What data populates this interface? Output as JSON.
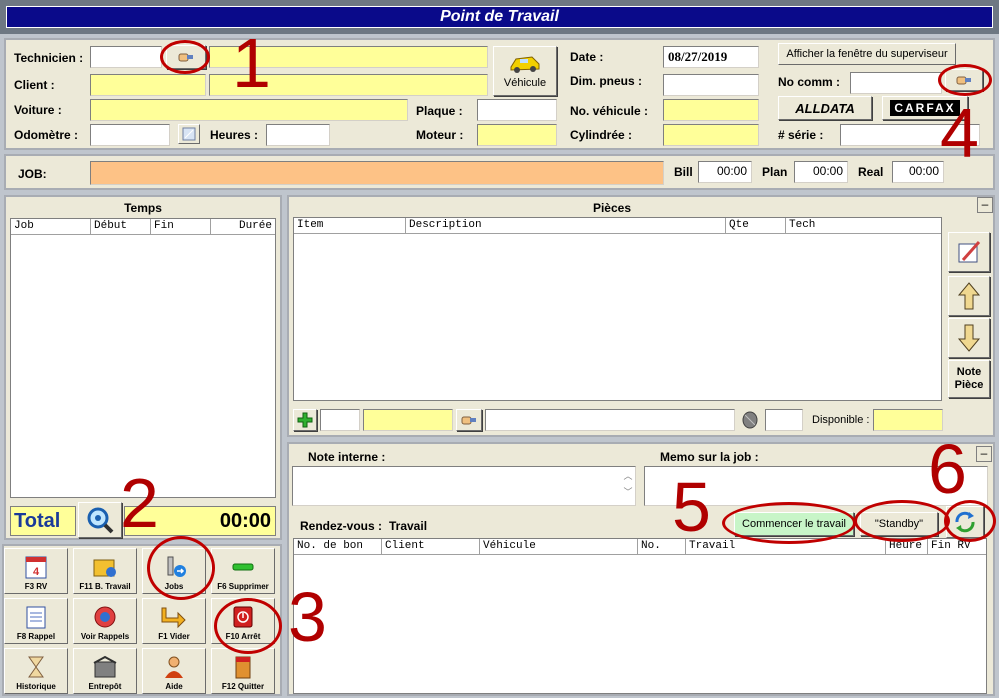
{
  "window": {
    "title": "Point de Travail"
  },
  "header": {
    "technicien_label": "Technicien :",
    "client_label": "Client :",
    "voiture_label": "Voiture :",
    "odometre_label": "Odomètre :",
    "heures_label": "Heures :",
    "plaque_label": "Plaque :",
    "moteur_label": "Moteur :",
    "vehicule_button": "Véhicule",
    "date_label": "Date :",
    "date_value": "08/27/2019",
    "dim_pneus_label": "Dim. pneus :",
    "no_vehicule_label": "No. véhicule :",
    "cylindree_label": "Cylindrée :",
    "superviseur_button": "Afficher la fenêtre du superviseur",
    "no_comm_label": "No comm :",
    "alldata_label": "ALLDATA",
    "carfax_label": "CARFAX",
    "serie_label": "# série :"
  },
  "job": {
    "label": "JOB:",
    "bill_label": "Bill",
    "bill_value": "00:00",
    "plan_label": "Plan",
    "plan_value": "00:00",
    "real_label": "Real",
    "real_value": "00:00"
  },
  "temps": {
    "title": "Temps",
    "columns": [
      "Job",
      "Début",
      "Fin",
      "Durée"
    ],
    "total_label": "Total",
    "total_value": "00:00"
  },
  "pieces": {
    "title": "Pièces",
    "columns": [
      "Item",
      "Description",
      "Qte",
      "Tech"
    ],
    "disponible_label": "Disponible :",
    "note_piece_label": "Note Pièce"
  },
  "notes": {
    "note_interne_label": "Note interne :",
    "memo_label": "Memo sur la job :"
  },
  "rdv": {
    "label": "Rendez-vous :",
    "travail_label": "Travail",
    "commencer_button": "Commencer le travail",
    "standby_button": "\"Standby\"",
    "columns": [
      "No. de bon",
      "Client",
      "Véhicule",
      "No.",
      "Travail",
      "Heure",
      "Fin RV"
    ]
  },
  "toolbar": {
    "tiles": [
      "F3 RV",
      "F11 B. Travail",
      "Jobs",
      "F6 Supprimer",
      "F8 Rappel",
      "Voir Rappels",
      "F1 Vider",
      "F10 Arrêt",
      "Historique",
      "Entrepôt",
      "Aide",
      "F12 Quitter"
    ]
  },
  "annotations": [
    "1",
    "2",
    "3",
    "4",
    "5",
    "6"
  ],
  "colors": {
    "title_bg": "#0a0a8a",
    "panel_bg": "#ece9d8",
    "required_field": "#ffff99",
    "job_field": "#fdc286",
    "annotation": "#b00000",
    "commencer_bg": "#c8f5c8"
  }
}
